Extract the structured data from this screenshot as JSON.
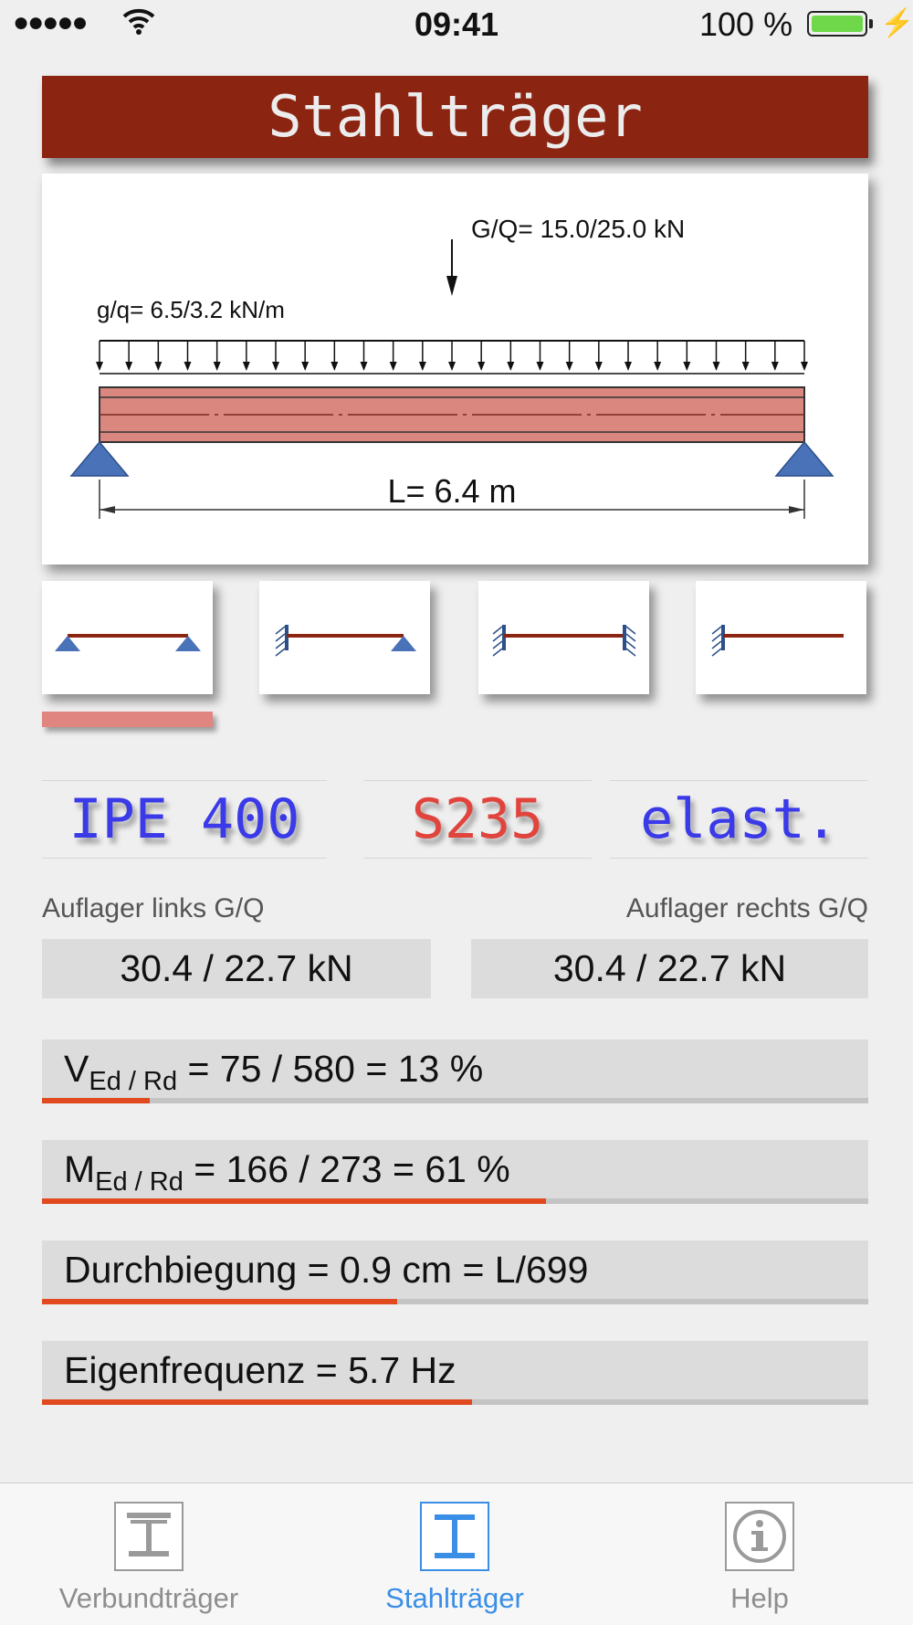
{
  "status": {
    "time": "09:41",
    "battery": "100 %",
    "signal": "●●●●●"
  },
  "title": "Stahlträger",
  "diagram": {
    "point_load": "G/Q= 15.0/25.0 kN",
    "distributed_load": "g/q= 6.5/3.2 kN/m",
    "span": "L= 6.4 m"
  },
  "support_types": [
    "simply-supported",
    "fixed-pinned",
    "fixed-fixed",
    "cantilever"
  ],
  "selected_support": 0,
  "params": {
    "profile": "IPE 400",
    "steel": "S235",
    "method": "elast."
  },
  "colors": {
    "profile": "#3a3ae8",
    "steel": "#e0443c",
    "method": "#3a3ae8",
    "accent": "#e04a1e",
    "title_bg": "#8b2512",
    "tab_active": "#3a8ee6"
  },
  "reactions": {
    "left_label": "Auflager links   G/Q",
    "right_label": "Auflager rechts   G/Q",
    "left_value": "30.4 / 22.7 kN",
    "right_value": "30.4 / 22.7 kN"
  },
  "checks": [
    {
      "sym": "V",
      "sub": "Ed / Rd",
      "text": " = 75 / 580 = 13 %",
      "ratio": 0.13
    },
    {
      "sym": "M",
      "sub": "Ed / Rd",
      "text": " = 166 / 273 = 61 %",
      "ratio": 0.61
    },
    {
      "sym": "",
      "sub": "",
      "text": "Durchbiegung = 0.9 cm = L/699",
      "ratio": 0.43
    },
    {
      "sym": "",
      "sub": "",
      "text": "Eigenfrequenz = 5.7 Hz",
      "ratio": 0.52
    }
  ],
  "tabs": [
    {
      "label": "Verbundträger",
      "icon": "composite-beam-icon"
    },
    {
      "label": "Stahlträger",
      "icon": "steel-beam-icon"
    },
    {
      "label": "Help",
      "icon": "info-icon"
    }
  ],
  "active_tab": 1
}
